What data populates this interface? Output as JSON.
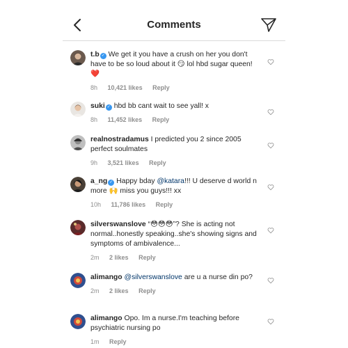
{
  "header": {
    "title": "Comments"
  },
  "comments": [
    {
      "username": "t.b",
      "verified": true,
      "parts": [
        "We get it you have a crush on her you don't have to be so loud about it ",
        "😏",
        " lol hbd sugar queen! ",
        "❤️"
      ],
      "time": "8h",
      "likes": "10,421 likes",
      "reply": "Reply"
    },
    {
      "username": "suki",
      "verified": true,
      "parts": [
        "hbd bb cant wait to see yall! x"
      ],
      "time": "8h",
      "likes": "11,452 likes",
      "reply": "Reply"
    },
    {
      "username": "realnostradamus",
      "verified": false,
      "parts": [
        "I predicted you 2 since 2005 perfect soulmates"
      ],
      "time": "9h",
      "likes": "3,521 likes",
      "reply": "Reply"
    },
    {
      "username": "a_ng",
      "verified": true,
      "parts": [
        "Happy bday ",
        "@katara",
        "!!! U deserve d world n more ",
        "🙌",
        " miss you guys!!! xx"
      ],
      "time": "10h",
      "likes": "11,786 likes",
      "reply": "Reply"
    },
    {
      "username": "silverswanslove",
      "verified": false,
      "parts": [
        "“",
        "😳😳😳",
        "”? She is acting not normal..honestly speaking..she's showing signs and symptoms of ambivalence..."
      ],
      "time": "2m",
      "likes": "2 likes",
      "reply": "Reply"
    },
    {
      "username": "alimango",
      "verified": false,
      "parts": [
        "@silverswanslove",
        " are u a nurse din po?"
      ],
      "time": "2m",
      "likes": "2 likes",
      "reply": "Reply"
    },
    {
      "username": "alimango",
      "verified": false,
      "parts": [
        "Opo. Im a nurse.I'm teaching before psychiatric nursing po"
      ],
      "time": "1m",
      "likes": "",
      "reply": "Reply"
    }
  ],
  "colors": {
    "verified": "#3897f0",
    "mention": "#003569",
    "meta": "#8e8e8e",
    "heart_red": "#ed4956"
  }
}
